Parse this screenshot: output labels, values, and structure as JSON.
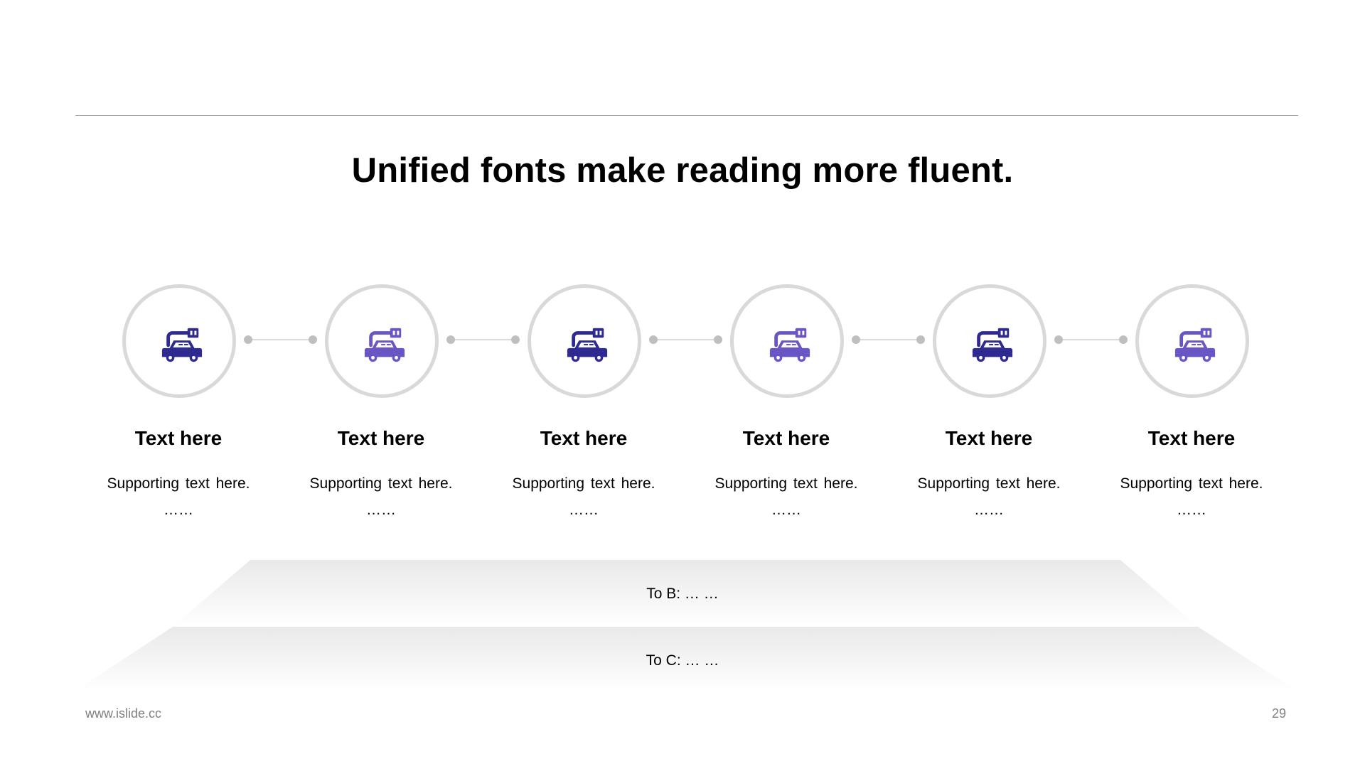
{
  "slide": {
    "title": "Unified fonts make reading more fluent.",
    "footer_url": "www.islide.cc",
    "page_number": "29"
  },
  "colors": {
    "icon_dark": "#2e2a8f",
    "icon_light": "#6a55c4",
    "circle_border": "#d9d9d9",
    "connector": "#d9d9d9",
    "connector_dot": "#bfbfbf",
    "rule": "#a6a6a6",
    "footer_text": "#7f7f7f"
  },
  "steps": [
    {
      "icon": "electric-car-charging-icon",
      "color": "icon_dark",
      "title": "Text here",
      "subtitle": "Supporting text here.",
      "dots": "……"
    },
    {
      "icon": "electric-car-charging-icon",
      "color": "icon_light",
      "title": "Text here",
      "subtitle": "Supporting text here.",
      "dots": "……"
    },
    {
      "icon": "electric-car-charging-icon",
      "color": "icon_dark",
      "title": "Text here",
      "subtitle": "Supporting text here.",
      "dots": "……"
    },
    {
      "icon": "electric-car-charging-icon",
      "color": "icon_light",
      "title": "Text here",
      "subtitle": "Supporting text here.",
      "dots": "……"
    },
    {
      "icon": "electric-car-charging-icon",
      "color": "icon_dark",
      "title": "Text here",
      "subtitle": "Supporting text here.",
      "dots": "……"
    },
    {
      "icon": "electric-car-charging-icon",
      "color": "icon_light",
      "title": "Text here",
      "subtitle": "Supporting text here.",
      "dots": "……"
    }
  ],
  "tiers": [
    {
      "label": "To B: … …"
    },
    {
      "label": "To C: … …"
    }
  ]
}
